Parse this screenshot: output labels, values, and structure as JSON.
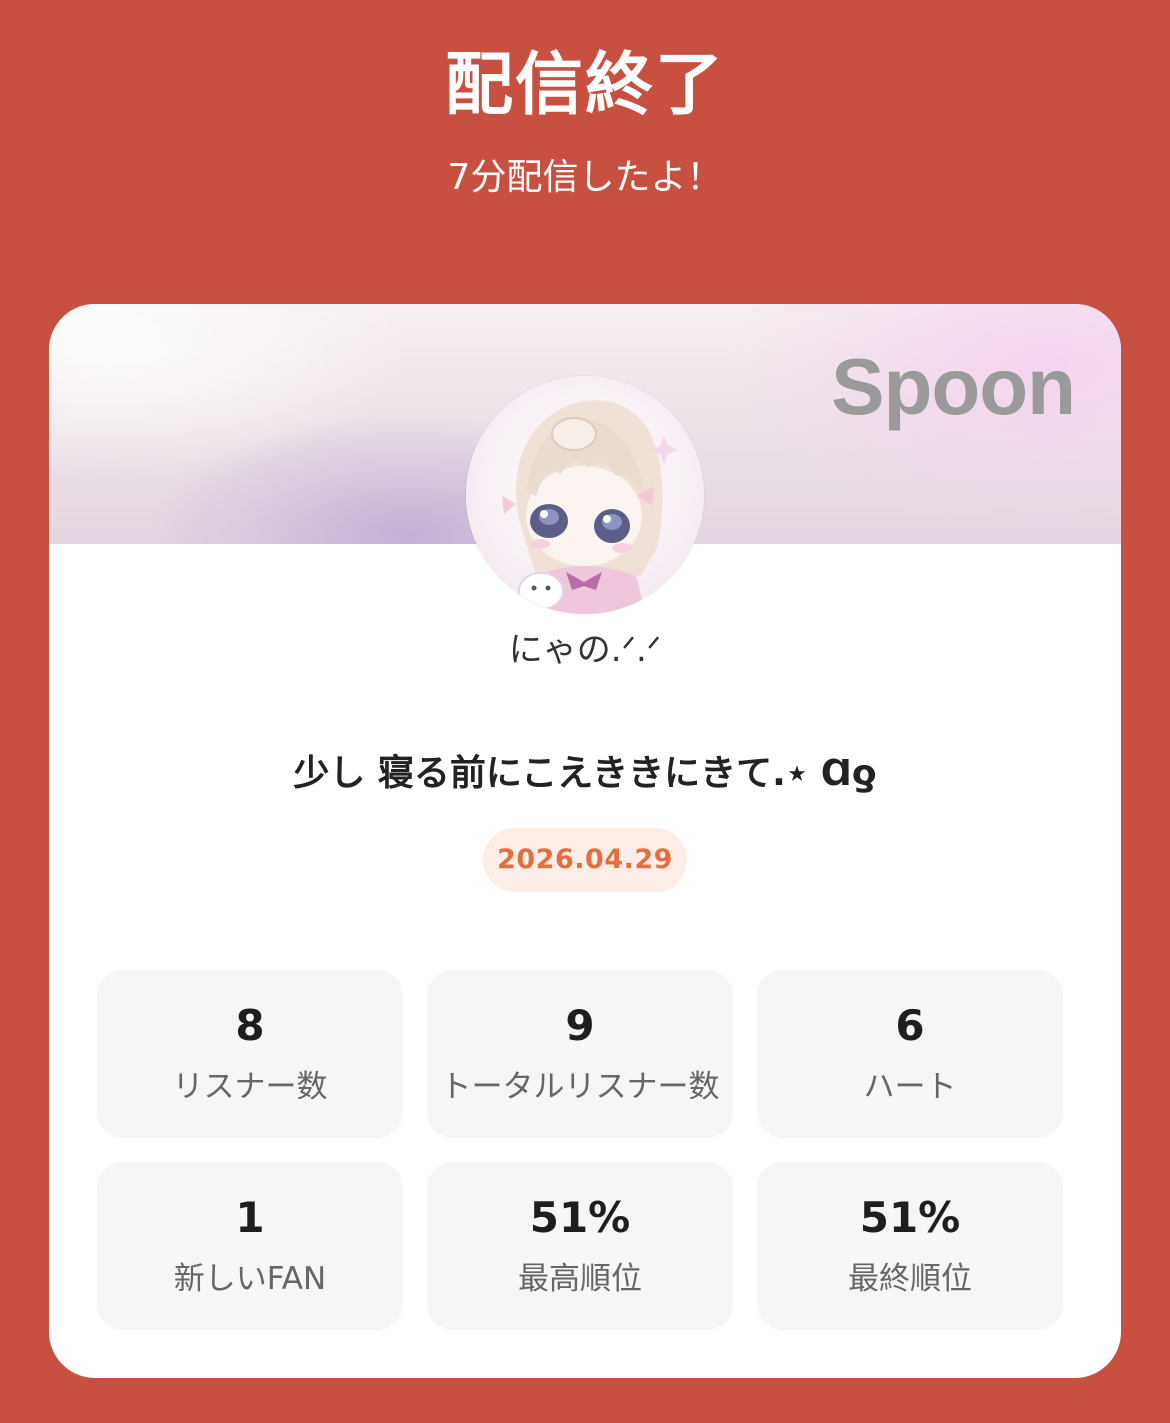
{
  "header": {
    "title": "配信終了",
    "subtitle": "7分配信したよ！"
  },
  "card": {
    "logo": "Spoon",
    "username": "にゃの.ᐟ.ᐟ",
    "live_title": "少し 寝る前にこえききにきて.⋆ Ɑƍ",
    "date": "2026.04.29",
    "stats": [
      {
        "value": "8",
        "label": "リスナー数"
      },
      {
        "value": "9",
        "label": "トータルリスナー数"
      },
      {
        "value": "6",
        "label": "ハート"
      },
      {
        "value": "1",
        "label": "新しいFAN"
      },
      {
        "value": "51%",
        "label": "最高順位"
      },
      {
        "value": "51%",
        "label": "最終順位"
      }
    ]
  },
  "colors": {
    "background": "#C75041",
    "date_text": "#E36E3F",
    "date_badge": "#FCEEE6",
    "stat_tile": "#F6F6F6"
  }
}
